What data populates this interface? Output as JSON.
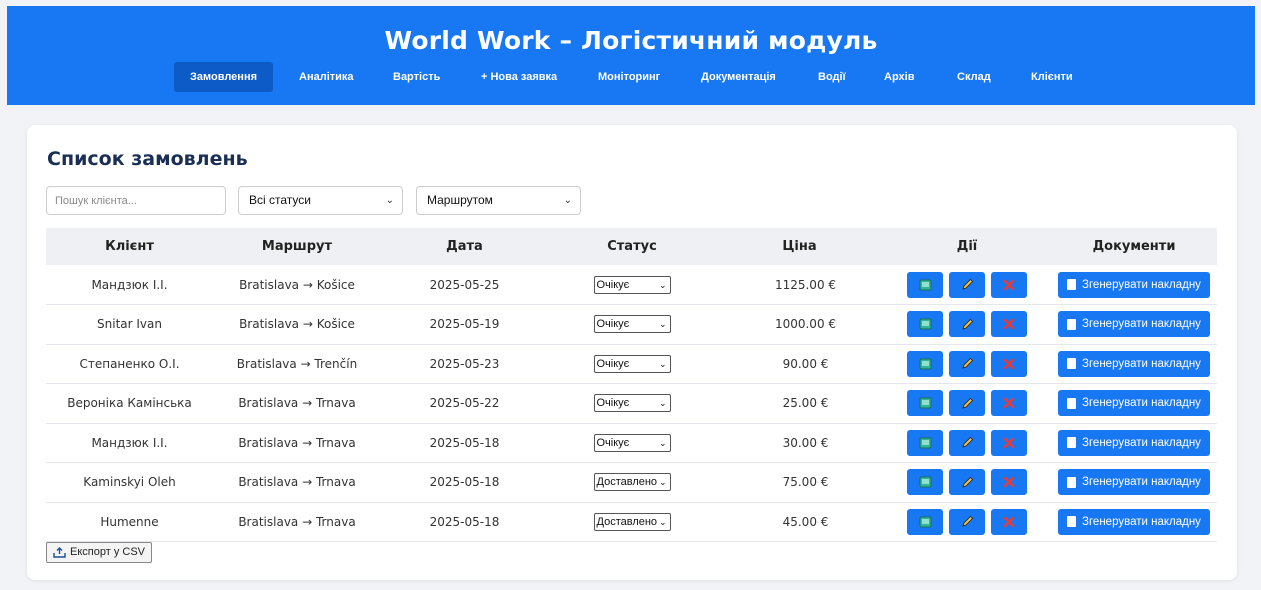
{
  "app": {
    "title": "World Work – Логістичний модуль"
  },
  "nav": [
    {
      "label": "Замовлення",
      "active": true
    },
    {
      "label": "Аналітика"
    },
    {
      "label": "Вартість"
    },
    {
      "label": "+ Нова заявка"
    },
    {
      "label": "Моніторинг"
    },
    {
      "label": "Документація"
    },
    {
      "label": "Водії"
    },
    {
      "label": "Архів"
    },
    {
      "label": "Склад"
    },
    {
      "label": "Клієнти"
    }
  ],
  "main": {
    "title": "Список замовлень",
    "search_placeholder": "Пошук клієнта...",
    "status_filter": "Всі статуси",
    "sort_filter": "Маршрутом",
    "export_label": "Експорт у CSV"
  },
  "table": {
    "headers": [
      "Клієнт",
      "Маршрут",
      "Дата",
      "Статус",
      "Ціна",
      "Дії",
      "Документи"
    ],
    "doc_button_label": "Згенерувати накладну",
    "rows": [
      {
        "client": "Мандзюк І.І.",
        "route": "Bratislava → Košice",
        "date": "2025-05-25",
        "status": "Очікує",
        "price": "1125.00 €"
      },
      {
        "client": "Snitar Ivan",
        "route": "Bratislava → Košice",
        "date": "2025-05-19",
        "status": "Очікує",
        "price": "1000.00 €"
      },
      {
        "client": "Степаненко О.І.",
        "route": "Bratislava → Trenčín",
        "date": "2025-05-23",
        "status": "Очікує",
        "price": "90.00 €"
      },
      {
        "client": "Вероніка Камінська",
        "route": "Bratislava → Trnava",
        "date": "2025-05-22",
        "status": "Очікує",
        "price": "25.00 €"
      },
      {
        "client": "Мандзюк І.І.",
        "route": "Bratislava → Trnava",
        "date": "2025-05-18",
        "status": "Очікує",
        "price": "30.00 €"
      },
      {
        "client": "Kaminskyi Oleh",
        "route": "Bratislava → Trnava",
        "date": "2025-05-18",
        "status": "Доставлено",
        "price": "75.00 €"
      },
      {
        "client": "Humenne",
        "route": "Bratislava → Trnava",
        "date": "2025-05-18",
        "status": "Доставлено",
        "price": "45.00 €"
      }
    ]
  },
  "colors": {
    "brand": "#1877f2",
    "nav_active": "#0d5bc6",
    "title": "#1a2f55"
  },
  "icons": {
    "view": "book-icon",
    "edit": "pencil-icon",
    "delete": "cross-mark-icon",
    "doc": "document-icon",
    "export": "tray-upload-icon"
  }
}
